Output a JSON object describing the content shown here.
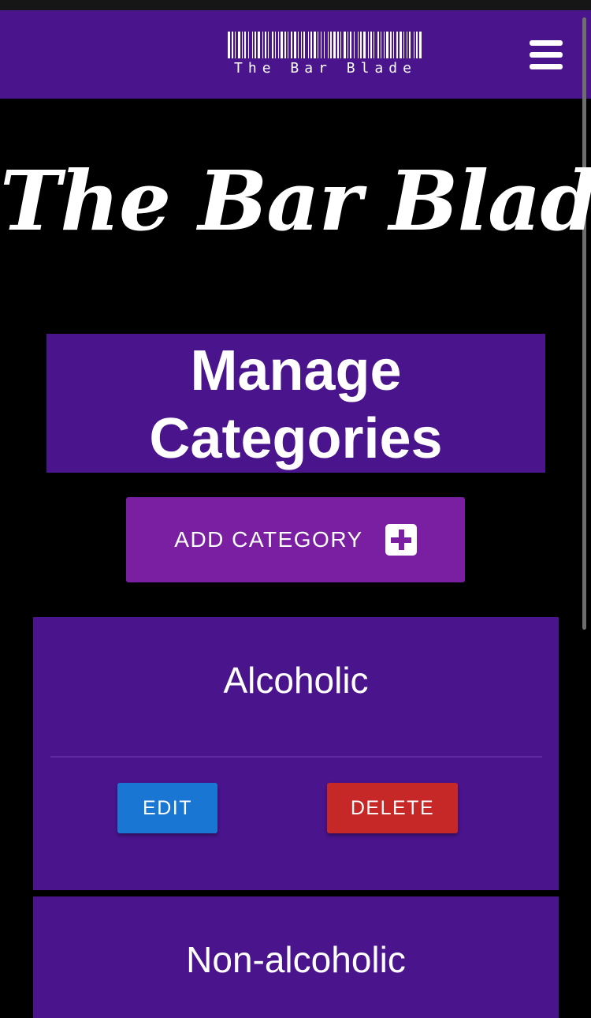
{
  "colors": {
    "background": "#000000",
    "primary": "#4a148c",
    "accent": "#7b1fa2",
    "edit": "#1976d2",
    "delete": "#c62828"
  },
  "navbar": {
    "logo_text": "The Bar Blade",
    "menu_icon": "hamburger-menu-icon"
  },
  "site_title": "The Bar Blade",
  "page_heading": {
    "line1": "Manage",
    "line2": "Categories"
  },
  "add_button": {
    "label": "ADD CATEGORY",
    "icon": "plus-box-icon"
  },
  "categories": [
    {
      "name": "Alcoholic",
      "edit_label": "EDIT",
      "delete_label": "DELETE"
    },
    {
      "name": "Non-alcoholic"
    }
  ]
}
